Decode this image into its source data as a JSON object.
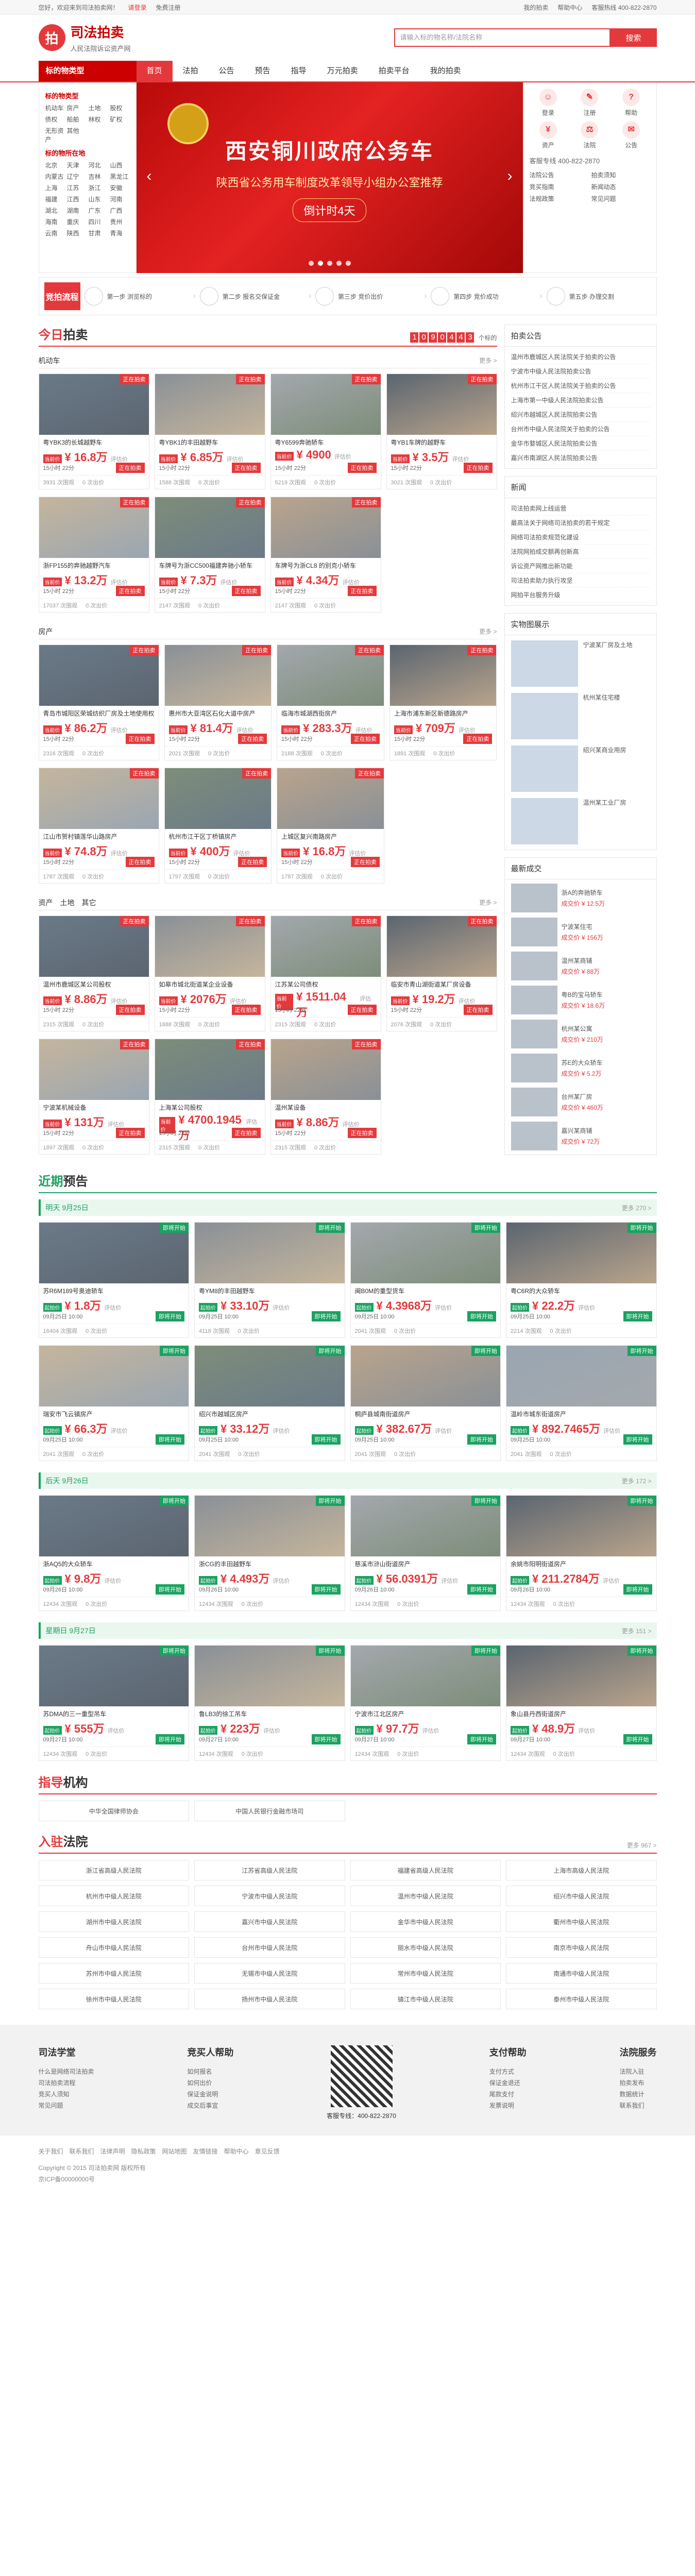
{
  "topbar": {
    "left": "您好，欢迎来到司法拍卖网！",
    "login": "请登录",
    "register": "免费注册",
    "links": [
      "我的拍卖",
      "帮助中心",
      "客服热线 400-822-2870"
    ]
  },
  "header": {
    "logo_text": "司法拍卖",
    "logo_sub": "人民法院诉讼资产网",
    "search_placeholder": "请输入标的物名称/法院名称",
    "search_btn": "搜索"
  },
  "nav": {
    "cat": "标的物类型",
    "items": [
      "首页",
      "法拍",
      "公告",
      "预告",
      "指导",
      "万元拍卖",
      "拍卖平台",
      "我的拍卖"
    ],
    "active": 0,
    "btn": "资产拍卖"
  },
  "cats": {
    "h1": "标的物类型",
    "types": [
      "机动车",
      "房产",
      "土地",
      "股权",
      "债权",
      "船舶",
      "林权",
      "矿权",
      "无形资产",
      "其他"
    ],
    "h2": "标的物所在地",
    "regions": [
      "北京",
      "天津",
      "河北",
      "山西",
      "内蒙古",
      "辽宁",
      "吉林",
      "黑龙江",
      "上海",
      "江苏",
      "浙江",
      "安徽",
      "福建",
      "江西",
      "山东",
      "河南",
      "湖北",
      "湖南",
      "广东",
      "广西",
      "海南",
      "重庆",
      "四川",
      "贵州",
      "云南",
      "陕西",
      "甘肃",
      "青海"
    ]
  },
  "banner": {
    "title": "西安铜川政府公务车",
    "subtitle": "陕西省公务用车制度改革领导小组办公室推荐",
    "countdown": "倒计时4天"
  },
  "side": {
    "icons": [
      "登录",
      "注册",
      "帮助",
      "资产",
      "法院",
      "公告"
    ],
    "tel": "客服专线 400-822-2870",
    "news": [
      "法院公告",
      "拍卖须知",
      "竞买指南",
      "新闻动态",
      "法规政策",
      "常见问题"
    ]
  },
  "flow": {
    "label": "竞拍流程",
    "steps": [
      "第一步 浏览标的",
      "第二步 报名交保证金",
      "第三步 竞价出价",
      "第四步 竞价成功",
      "第五步 办理交割"
    ]
  },
  "today": {
    "title_red": "今日",
    "title_black": "拍卖",
    "count_digits": [
      "1",
      "0",
      "9",
      "0",
      "4",
      "4",
      "3"
    ],
    "count_label": "个标的"
  },
  "vehicles": {
    "label": "机动车",
    "more": "更多 >"
  },
  "vehicle_cards": [
    {
      "name": "粤YBK3的长城越野车",
      "label": "当前价",
      "price": "¥ 16.8万",
      "eval": "评估价",
      "time": "15小时 22分",
      "btn": "正在拍卖",
      "views": "3931 次围观",
      "bids": "0 次出价"
    },
    {
      "name": "粤YBK1的丰田越野车",
      "label": "当前价",
      "price": "¥ 6.85万",
      "eval": "评估价",
      "time": "15小时 22分",
      "btn": "正在拍卖",
      "views": "1588 次围观",
      "bids": "0 次出价"
    },
    {
      "name": "粤Y6599奔驰轿车",
      "label": "当前价",
      "price": "¥ 4900",
      "eval": "评估价",
      "time": "15小时 22分",
      "btn": "正在拍卖",
      "views": "5219 次围观",
      "bids": "0 次出价"
    },
    {
      "name": "粤YB1车牌的越野车",
      "label": "当前价",
      "price": "¥ 3.5万",
      "eval": "评估价",
      "time": "15小时 22分",
      "btn": "正在拍卖",
      "views": "3021 次围观",
      "bids": "0 次出价"
    },
    {
      "name": "浙FP155的奔驰越野汽车",
      "label": "当前价",
      "price": "¥ 13.2万",
      "eval": "评估价",
      "time": "15小时 22分",
      "btn": "正在拍卖",
      "views": "17037 次围观",
      "bids": "0 次出价"
    },
    {
      "name": "车牌号为浙CC500福建奔驰小轿车",
      "label": "当前价",
      "price": "¥ 7.3万",
      "eval": "评估价",
      "time": "15小时 22分",
      "btn": "正在拍卖",
      "views": "2147 次围观",
      "bids": "0 次出价"
    },
    {
      "name": "车牌号为浙CL8 的别克小轿车",
      "label": "当前价",
      "price": "¥ 4.34万",
      "eval": "评估价",
      "time": "15小时 22分",
      "btn": "正在拍卖",
      "views": "2147 次围观",
      "bids": "0 次出价"
    }
  ],
  "house": {
    "label": "房产",
    "more": "更多 >"
  },
  "house_cards": [
    {
      "name": "青岛市城阳区荣城纺织厂房及土地使用权",
      "label": "当前价",
      "price": "¥ 86.2万",
      "eval": "评估价",
      "time": "15小时 22分",
      "btn": "正在拍卖",
      "views": "2316 次围观",
      "bids": "0 次出价"
    },
    {
      "name": "惠州市大亚湾区石化大道中房产",
      "label": "当前价",
      "price": "¥ 81.4万",
      "eval": "评估价",
      "time": "15小时 22分",
      "btn": "正在拍卖",
      "views": "2021 次围观",
      "bids": "0 次出价"
    },
    {
      "name": "临海市城湖西街房产",
      "label": "当前价",
      "price": "¥ 283.3万",
      "eval": "评估价",
      "time": "15小时 22分",
      "btn": "正在拍卖",
      "views": "2188 次围观",
      "bids": "0 次出价"
    },
    {
      "name": "上海市浦东新区新德路房产",
      "label": "当前价",
      "price": "¥ 709万",
      "eval": "评估价",
      "time": "15小时 22分",
      "btn": "正在拍卖",
      "views": "1891 次围观",
      "bids": "0 次出价"
    },
    {
      "name": "江山市贺村镇莲华山路房产",
      "label": "当前价",
      "price": "¥ 74.8万",
      "eval": "评估价",
      "time": "15小时 22分",
      "btn": "正在拍卖",
      "views": "1787 次围观",
      "bids": "0 次出价"
    },
    {
      "name": "杭州市江干区丁桥镇房产",
      "label": "当前价",
      "price": "¥ 400万",
      "eval": "评估价",
      "time": "15小时 22分",
      "btn": "正在拍卖",
      "views": "1797 次围观",
      "bids": "0 次出价"
    },
    {
      "name": "上城区复兴南路房产",
      "label": "当前价",
      "price": "¥ 16.8万",
      "eval": "评估价",
      "time": "15小时 22分",
      "btn": "正在拍卖",
      "views": "1787 次围观",
      "bids": "0 次出价"
    }
  ],
  "assets": {
    "tabs": [
      "资产",
      "土地",
      "其它"
    ],
    "more": "更多 >"
  },
  "asset_cards": [
    {
      "name": "温州市鹿城区某公司股权",
      "label": "当前价",
      "price": "¥ 8.86万",
      "eval": "评估价",
      "time": "15小时 22分",
      "btn": "正在拍卖",
      "views": "2315 次围观",
      "bids": "0 次出价"
    },
    {
      "name": "如皋市城北街道某企业设备",
      "label": "当前价",
      "price": "¥ 2076万",
      "eval": "评估价",
      "time": "15小时 22分",
      "btn": "正在拍卖",
      "views": "1888 次围观",
      "bids": "0 次出价"
    },
    {
      "name": "江苏某公司债权",
      "label": "当前价",
      "price": "¥ 1511.04万",
      "eval": "评估价",
      "time": "15小时 22分",
      "btn": "正在拍卖",
      "views": "2315 次围观",
      "bids": "0 次出价"
    },
    {
      "name": "临安市青山湖街道某厂房设备",
      "label": "当前价",
      "price": "¥ 19.2万",
      "eval": "评估价",
      "time": "15小时 22分",
      "btn": "正在拍卖",
      "views": "2076 次围观",
      "bids": "0 次出价"
    },
    {
      "name": "宁波某机械设备",
      "label": "当前价",
      "price": "¥ 131万",
      "eval": "评估价",
      "time": "15小时 22分",
      "btn": "正在拍卖",
      "views": "1897 次围观",
      "bids": "0 次出价"
    },
    {
      "name": "上海某公司股权",
      "label": "当前价",
      "price": "¥ 4700.1945万",
      "eval": "评估价",
      "time": "15小时 22分",
      "btn": "正在拍卖",
      "views": "2315 次围观",
      "bids": "0 次出价"
    },
    {
      "name": "温州某设备",
      "label": "当前价",
      "price": "¥ 8.86万",
      "eval": "评估价",
      "time": "15小时 22分",
      "btn": "正在拍卖",
      "views": "2315 次围观",
      "bids": "0 次出价"
    }
  ],
  "preview": {
    "title_red": "近期",
    "title_black": "预告"
  },
  "day1": {
    "badge": "明天",
    "label": "明天 9月25日",
    "more": "更多 270 >"
  },
  "day1_cards": [
    {
      "name": "苏R6M189号奥迪轿车",
      "label": "起拍价",
      "price": "¥ 1.8万",
      "eval": "评估价",
      "time": "09月25日 10:00",
      "btn": "即将开始",
      "views": "16404 次围观",
      "bids": "0 次出价"
    },
    {
      "name": "粤YM8的丰田越野车",
      "label": "起拍价",
      "price": "¥ 33.10万",
      "eval": "评估价",
      "time": "09月25日 10:00",
      "btn": "即将开始",
      "views": "4118 次围观",
      "bids": "0 次出价"
    },
    {
      "name": "闽B0M的重型货车",
      "label": "起拍价",
      "price": "¥ 4.3968万",
      "eval": "评估价",
      "time": "09月25日 10:00",
      "btn": "即将开始",
      "views": "2041 次围观",
      "bids": "0 次出价"
    },
    {
      "name": "粤C6R的大众轿车",
      "label": "起拍价",
      "price": "¥ 22.2万",
      "eval": "评估价",
      "time": "09月25日 10:00",
      "btn": "即将开始",
      "views": "2214 次围观",
      "bids": "0 次出价"
    },
    {
      "name": "瑞安市飞云镇房产",
      "label": "起拍价",
      "price": "¥ 66.3万",
      "eval": "评估价",
      "time": "09月25日 10:00",
      "btn": "即将开始",
      "views": "2041 次围观",
      "bids": "0 次出价"
    },
    {
      "name": "绍兴市越城区房产",
      "label": "起拍价",
      "price": "¥ 33.12万",
      "eval": "评估价",
      "time": "09月25日 10:00",
      "btn": "即将开始",
      "views": "2041 次围观",
      "bids": "0 次出价"
    },
    {
      "name": "桐庐县城南街道房产",
      "label": "起拍价",
      "price": "¥ 382.67万",
      "eval": "评估价",
      "time": "09月25日 10:00",
      "btn": "即将开始",
      "views": "2041 次围观",
      "bids": "0 次出价"
    },
    {
      "name": "温岭市城东街道房产",
      "label": "起拍价",
      "price": "¥ 892.7465万",
      "eval": "评估价",
      "time": "09月25日 10:00",
      "btn": "即将开始",
      "views": "2041 次围观",
      "bids": "0 次出价"
    }
  ],
  "day2": {
    "badge": "后天",
    "label": "后天 9月26日",
    "more": "更多 172 >"
  },
  "day2_cards": [
    {
      "name": "浙AQ5的大众轿车",
      "label": "起拍价",
      "price": "¥ 9.8万",
      "eval": "评估价",
      "time": "09月26日 10:00",
      "btn": "即将开始",
      "views": "12434 次围观",
      "bids": "0 次出价"
    },
    {
      "name": "浙CG的丰田越野车",
      "label": "起拍价",
      "price": "¥ 4.493万",
      "eval": "评估价",
      "time": "09月26日 10:00",
      "btn": "即将开始",
      "views": "12434 次围观",
      "bids": "0 次出价"
    },
    {
      "name": "慈溪市浒山街道房产",
      "label": "起拍价",
      "price": "¥ 56.0391万",
      "eval": "评估价",
      "time": "09月26日 10:00",
      "btn": "即将开始",
      "views": "12434 次围观",
      "bids": "0 次出价"
    },
    {
      "name": "余姚市阳明街道房产",
      "label": "起拍价",
      "price": "¥ 211.2784万",
      "eval": "评估价",
      "time": "09月26日 10:00",
      "btn": "即将开始",
      "views": "12434 次围观",
      "bids": "0 次出价"
    }
  ],
  "day3": {
    "badge": "星期日",
    "label": "星期日 9月27日",
    "more": "更多 151 >"
  },
  "day3_cards": [
    {
      "name": "苏DMA的三一重型吊车",
      "label": "起拍价",
      "price": "¥ 555万",
      "eval": "评估价",
      "time": "09月27日 10:00",
      "btn": "即将开始",
      "views": "12434 次围观",
      "bids": "0 次出价"
    },
    {
      "name": "鲁LB3的徐工吊车",
      "label": "起拍价",
      "price": "¥ 223万",
      "eval": "评估价",
      "time": "09月27日 10:00",
      "btn": "即将开始",
      "views": "12434 次围观",
      "bids": "0 次出价"
    },
    {
      "name": "宁波市江北区房产",
      "label": "起拍价",
      "price": "¥ 97.7万",
      "eval": "评估价",
      "time": "09月27日 10:00",
      "btn": "即将开始",
      "views": "12434 次围观",
      "bids": "0 次出价"
    },
    {
      "name": "象山县丹西街道房产",
      "label": "起拍价",
      "price": "¥ 48.9万",
      "eval": "评估价",
      "time": "09月27日 10:00",
      "btn": "即将开始",
      "views": "12434 次围观",
      "bids": "0 次出价"
    }
  ],
  "right": {
    "notice_title": "拍卖公告",
    "notices": [
      "温州市鹿城区人民法院关于拍卖的公告",
      "宁波市中级人民法院拍卖公告",
      "杭州市江干区人民法院关于拍卖的公告",
      "上海市第一中级人民法院拍卖公告",
      "绍兴市越城区人民法院拍卖公告",
      "台州市中级人民法院关于拍卖的公告",
      "金华市婺城区人民法院拍卖公告",
      "嘉兴市南湖区人民法院拍卖公告"
    ],
    "news_title": "新闻",
    "news": [
      "司法拍卖网上线运营",
      "最高法关于网络司法拍卖的若干规定",
      "网络司法拍卖规范化建设",
      "法院网拍成交额再创新高",
      "诉讼资产网推出新功能",
      "司法拍卖助力执行攻坚",
      "网拍平台服务升级"
    ],
    "photo_title": "实物图展示",
    "photos": [
      "宁波某厂房及土地",
      "杭州某住宅楼",
      "绍兴某商业用房",
      "温州某工业厂房"
    ],
    "recent_title": "最新成交",
    "recent": [
      {
        "t": "浙A的奔驰轿车",
        "p": "成交价 ¥ 12.5万"
      },
      {
        "t": "宁波某住宅",
        "p": "成交价 ¥ 156万"
      },
      {
        "t": "温州某商铺",
        "p": "成交价 ¥ 88万"
      },
      {
        "t": "粤B的宝马轿车",
        "p": "成交价 ¥ 18.6万"
      },
      {
        "t": "杭州某公寓",
        "p": "成交价 ¥ 210万"
      },
      {
        "t": "苏E的大众轿车",
        "p": "成交价 ¥ 5.2万"
      },
      {
        "t": "台州某厂房",
        "p": "成交价 ¥ 460万"
      },
      {
        "t": "嘉兴某商铺",
        "p": "成交价 ¥ 72万"
      }
    ]
  },
  "guide": {
    "title_red": "指导",
    "title_black": "机构",
    "items": [
      "中华全国律师协会",
      "中国人民银行金融市场司"
    ]
  },
  "court": {
    "title_red": "入驻",
    "title_black": "法院",
    "more": "更多 967 >",
    "items": [
      "浙江省高级人民法院",
      "江苏省高级人民法院",
      "福建省高级人民法院",
      "上海市高级人民法院",
      "杭州市中级人民法院",
      "宁波市中级人民法院",
      "温州市中级人民法院",
      "绍兴市中级人民法院",
      "湖州市中级人民法院",
      "嘉兴市中级人民法院",
      "金华市中级人民法院",
      "衢州市中级人民法院",
      "舟山市中级人民法院",
      "台州市中级人民法院",
      "丽水市中级人民法院",
      "南京市中级人民法院",
      "苏州市中级人民法院",
      "无锡市中级人民法院",
      "常州市中级人民法院",
      "南通市中级人民法院",
      "徐州市中级人民法院",
      "扬州市中级人民法院",
      "镇江市中级人民法院",
      "泰州市中级人民法院"
    ]
  },
  "footer": {
    "cols": [
      {
        "h": "司法学堂",
        "items": [
          "什么是网络司法拍卖",
          "司法拍卖流程",
          "竞买人须知",
          "常见问题"
        ]
      },
      {
        "h": "竞买人帮助",
        "items": [
          "如何报名",
          "如何出价",
          "保证金说明",
          "成交后事宜"
        ]
      },
      {
        "h": "支付帮助",
        "items": [
          "支付方式",
          "保证金退还",
          "尾款支付",
          "发票说明"
        ]
      },
      {
        "h": "法院服务",
        "items": [
          "法院入驻",
          "拍卖发布",
          "数据统计",
          "联系我们"
        ]
      }
    ],
    "tel": "客服专线：400-822-2870"
  },
  "bottom": {
    "links": [
      "关于我们",
      "联系我们",
      "法律声明",
      "隐私政策",
      "网站地图",
      "友情链接",
      "帮助中心",
      "意见反馈"
    ],
    "copy": "Copyright © 2015 司法拍卖网 版权所有",
    "icp": "京ICP备00000000号"
  }
}
